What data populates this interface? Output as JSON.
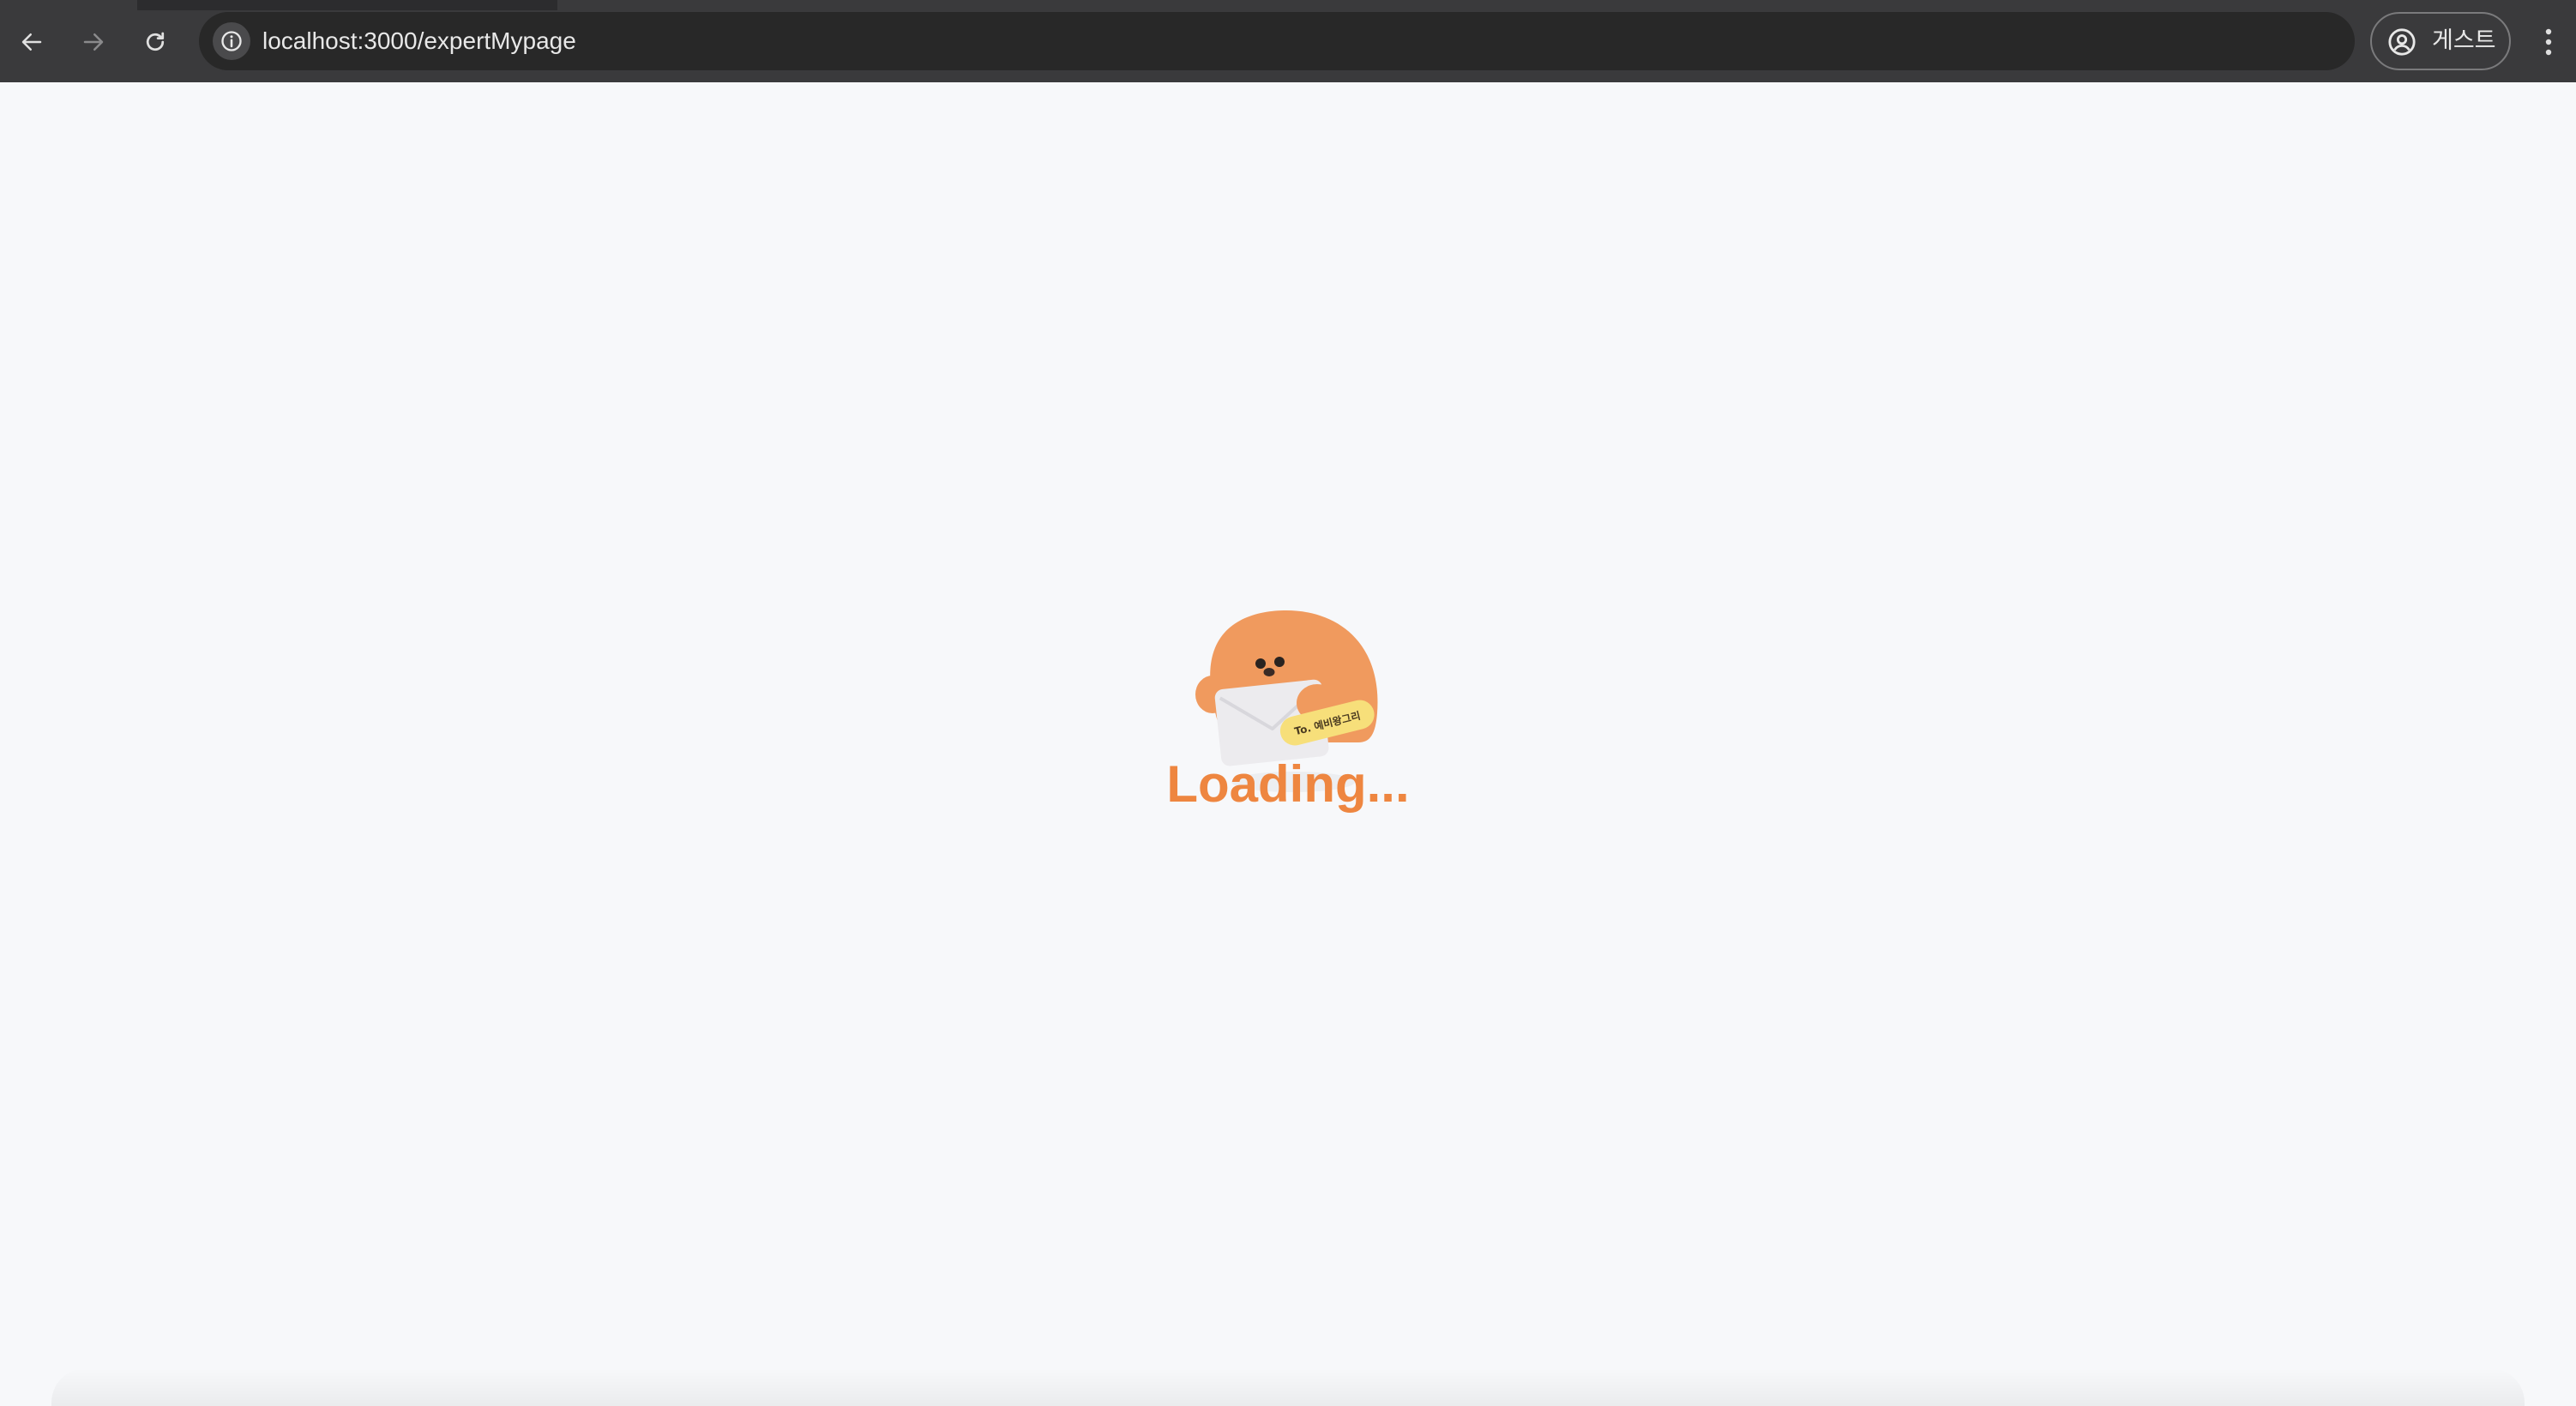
{
  "browser": {
    "url": "localhost:3000/expertMypage",
    "profile_label": "게스트",
    "back_icon": "arrow-left-icon",
    "forward_icon": "arrow-right-icon",
    "reload_icon": "reload-icon",
    "site_info_icon": "info-icon",
    "profile_icon": "account-circle-icon",
    "menu_icon": "more-vertical-icon"
  },
  "page": {
    "loading_text": "Loading...",
    "mascot_tag_text": "To. 예비왕그리",
    "mascot_icon": "mascot-with-envelope-icon"
  },
  "colors": {
    "toolbar": "#3a3a3c",
    "omnibox": "#282828",
    "page_background": "#f7f8fa",
    "accent_orange": "#ee8640",
    "mascot_body": "#f09a5e",
    "tag_yellow": "#f7df7a"
  }
}
